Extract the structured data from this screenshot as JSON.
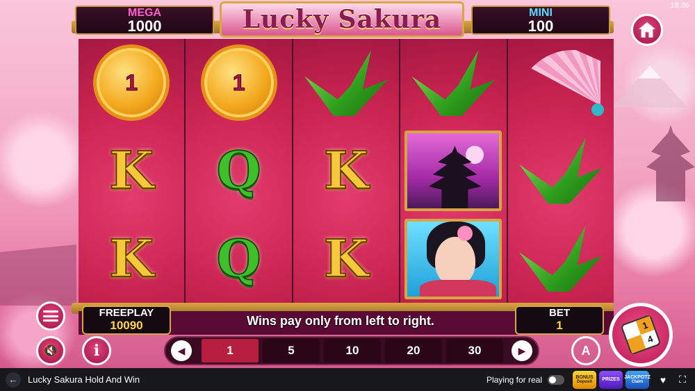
{
  "game": {
    "title": "Lucky Sakura",
    "clock": "18:36"
  },
  "jackpots": {
    "mega": {
      "label": "MEGA",
      "value": "1000"
    },
    "mini": {
      "label": "MINI",
      "value": "100"
    }
  },
  "reels": [
    [
      {
        "type": "coin",
        "text": "1"
      },
      {
        "type": "K",
        "text": "K"
      },
      {
        "type": "K",
        "text": "K"
      }
    ],
    [
      {
        "type": "coin",
        "text": "1"
      },
      {
        "type": "Q",
        "text": "Q"
      },
      {
        "type": "Q",
        "text": "Q"
      }
    ],
    [
      {
        "type": "crane"
      },
      {
        "type": "K",
        "text": "K"
      },
      {
        "type": "K",
        "text": "K"
      }
    ],
    [
      {
        "type": "crane"
      },
      {
        "type": "temple"
      },
      {
        "type": "geisha"
      }
    ],
    [
      {
        "type": "fan"
      },
      {
        "type": "crane"
      },
      {
        "type": "crane"
      }
    ]
  ],
  "panel": {
    "freeplay_label": "FREEPLAY",
    "freeplay_value": "10090",
    "bet_label": "BET",
    "bet_value": "1",
    "message": "Wins pay only from left to right."
  },
  "bet_options": [
    "1",
    "5",
    "10",
    "20",
    "30"
  ],
  "selected_bet": "1",
  "buttons": {
    "auto_label": "A",
    "info_label": "i",
    "sound_icon": "🔇",
    "spin_dice": [
      "",
      "1",
      "",
      "4"
    ]
  },
  "footer": {
    "title": "Lucky Sakura Hold And Win",
    "playing_for_real": "Playing for real",
    "promos": [
      {
        "top": "BONUS",
        "bottom": "Deposit"
      },
      {
        "top": "PRIZES",
        "bottom": ""
      },
      {
        "top": "JACKPOTZ",
        "bottom": "Claim"
      }
    ]
  },
  "colors": {
    "accent": "#c7234f",
    "gold": "#d7a741",
    "mega": "#ff5fd2",
    "mini": "#5fd8ff"
  }
}
